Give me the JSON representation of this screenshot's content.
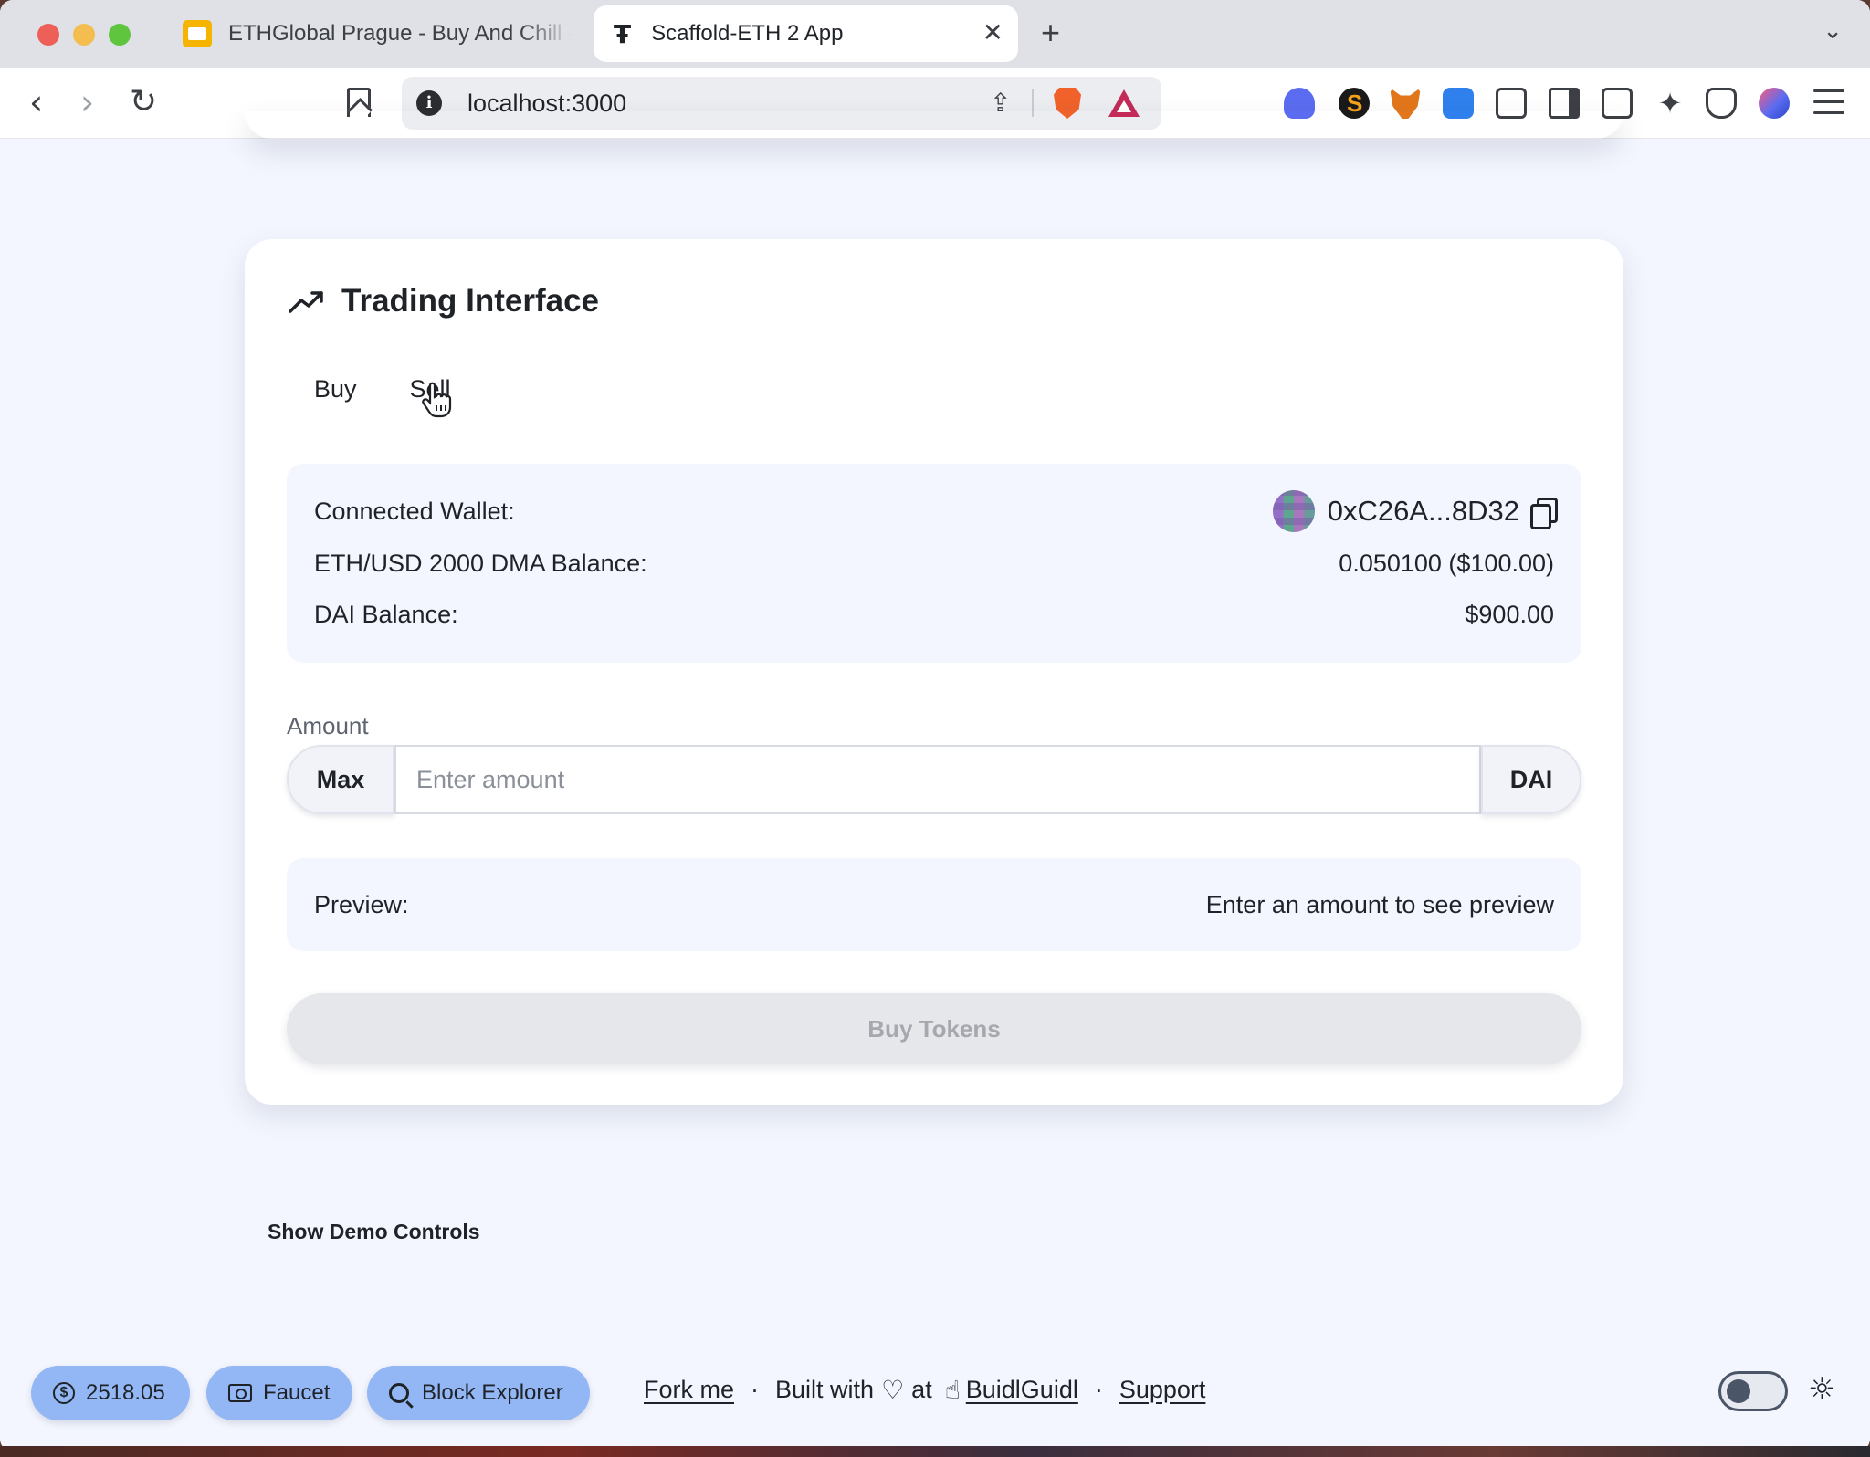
{
  "browser": {
    "tabs": [
      {
        "title": "ETHGlobal Prague - Buy And Chill -"
      },
      {
        "title": "Scaffold-ETH 2 App"
      }
    ],
    "new_tab": "+",
    "url": "localhost:3000",
    "extension_icons": [
      "sonar-icon",
      "s-extension-icon",
      "metamask-icon",
      "wave-icon",
      "puzzle-icon",
      "sidebar-icon",
      "wallet-icon",
      "sparkle-icon",
      "shield-icon",
      "globe-extension-icon"
    ]
  },
  "card": {
    "title": "Trading Interface",
    "tabs": [
      {
        "label": "Buy"
      },
      {
        "label": "Sell"
      }
    ],
    "info": {
      "wallet_label": "Connected Wallet:",
      "wallet_address": "0xC26A...8D32",
      "eth_label": "ETH/USD 2000 DMA Balance:",
      "eth_value": "0.050100 ($100.00)",
      "dai_label": "DAI Balance:",
      "dai_value": "$900.00"
    },
    "amount": {
      "label": "Amount",
      "max_label": "Max",
      "placeholder": "Enter amount",
      "value": "",
      "currency": "DAI"
    },
    "preview": {
      "label": "Preview:",
      "text": "Enter an amount to see preview"
    },
    "submit_label": "Buy Tokens"
  },
  "demo_controls_label": "Show Demo Controls",
  "footer": {
    "price": "2518.05",
    "faucet_label": "Faucet",
    "explorer_label": "Block Explorer",
    "fork_label": "Fork me",
    "built_with": "Built with",
    "at": "at",
    "buidlguidl": "BuidlGuidl",
    "support": "Support",
    "separator": "·"
  },
  "colors": {
    "page_bg": "#f3f6fe",
    "pill_bg": "#93b7f5",
    "disabled_button": "#e6e7ea"
  }
}
